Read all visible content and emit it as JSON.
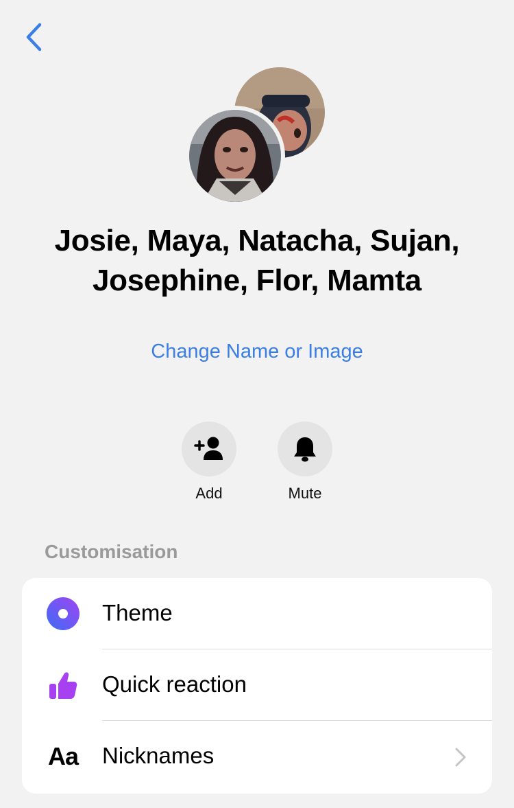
{
  "header": {
    "back_icon": "chevron-left-icon"
  },
  "conversation": {
    "title_line1": "Josie, Maya, Natacha, Sujan,",
    "title_line2": "Josephine, Flor, Mamta",
    "change_link": "Change Name or Image"
  },
  "actions": [
    {
      "label": "Add",
      "icon": "add-person-icon"
    },
    {
      "label": "Mute",
      "icon": "bell-icon"
    }
  ],
  "customisation": {
    "title": "Customisation",
    "items": [
      {
        "label": "Theme",
        "icon": "theme-icon"
      },
      {
        "label": "Quick reaction",
        "icon": "thumbs-up-icon"
      },
      {
        "label": "Nicknames",
        "icon": "nicknames-aa-icon",
        "icon_text": "Aa"
      }
    ]
  },
  "colors": {
    "accent": "#3b7ee6",
    "background": "#f2f2f2",
    "reaction_purple": "#a640f0"
  }
}
